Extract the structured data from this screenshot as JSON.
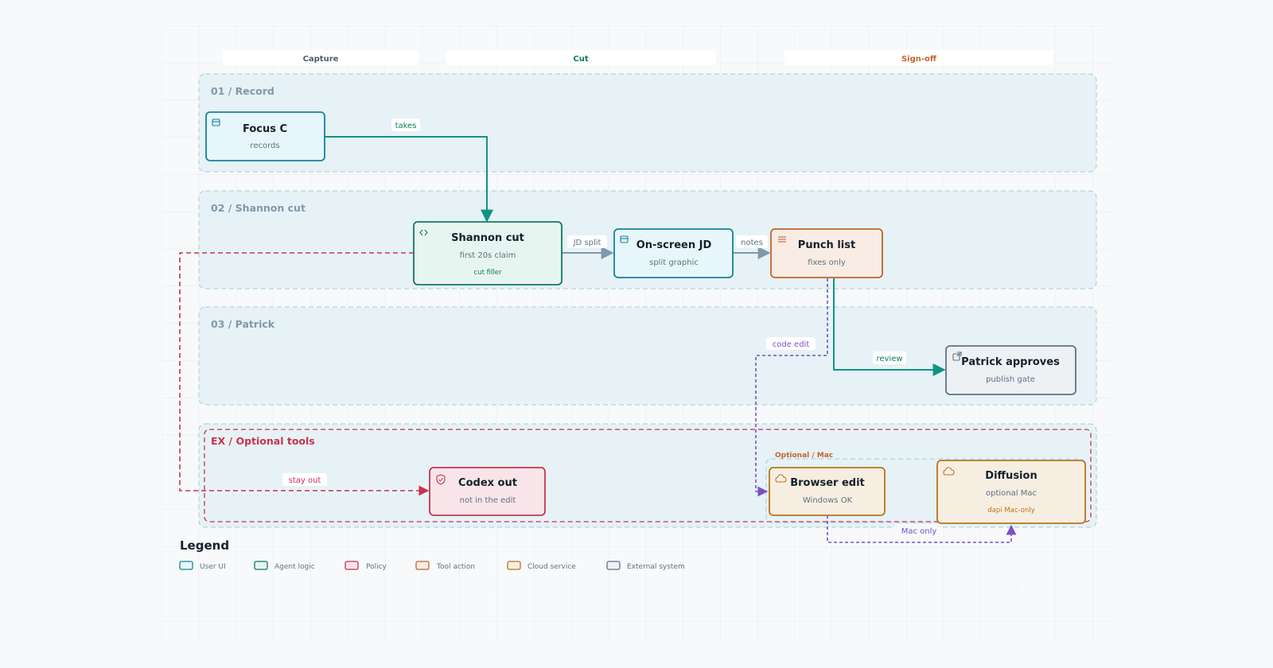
{
  "columns": {
    "capture": "Capture",
    "cut": "Cut",
    "signoff": "Sign-off"
  },
  "lanes": {
    "record": "01 / Record",
    "shannon": "02 / Shannon cut",
    "patrick": "03 / Patrick",
    "optional": "EX / Optional tools"
  },
  "groups": {
    "optional_mac": "Optional / Mac"
  },
  "nodes": {
    "focus_c": {
      "title": "Focus C",
      "sub": "records",
      "icon": "window-icon"
    },
    "shannon_cut": {
      "title": "Shannon cut",
      "sub": "first 20s claim",
      "tag": "cut filler",
      "icon": "code-icon"
    },
    "onscreen_jd": {
      "title": "On-screen JD",
      "sub": "split graphic",
      "icon": "window-icon"
    },
    "punch_list": {
      "title": "Punch list",
      "sub": "fixes only",
      "icon": "list-icon"
    },
    "patrick_approves": {
      "title": "Patrick approves",
      "sub": "publish gate",
      "icon": "external-link-icon"
    },
    "codex_out": {
      "title": "Codex out",
      "sub": "not in the edit",
      "icon": "shield-icon"
    },
    "browser_edit": {
      "title": "Browser edit",
      "sub": "Windows OK",
      "icon": "cloud-icon"
    },
    "diffusion": {
      "title": "Diffusion",
      "sub": "optional Mac",
      "tag": "dapi Mac-only",
      "icon": "cloud-icon"
    }
  },
  "edges": {
    "takes": "takes",
    "jd_split": "JD split",
    "notes": "notes",
    "review": "review",
    "code_edit": "code edit",
    "stay_out": "stay out",
    "mac_only": "Mac only"
  },
  "legend": {
    "title": "Legend",
    "items": [
      "User UI",
      "Agent logic",
      "Policy",
      "Tool action",
      "Cloud service",
      "External system"
    ]
  },
  "colors": {
    "user_ui": "#14829a",
    "agent_logic": "#0f8a6e",
    "policy": "#c8334e",
    "tool_action": "#c4642a",
    "cloud_service": "#b8741a",
    "external_system": "#5f7282",
    "cut_edge": "#0f9484",
    "dashed_purple": "#7a4fc8"
  }
}
